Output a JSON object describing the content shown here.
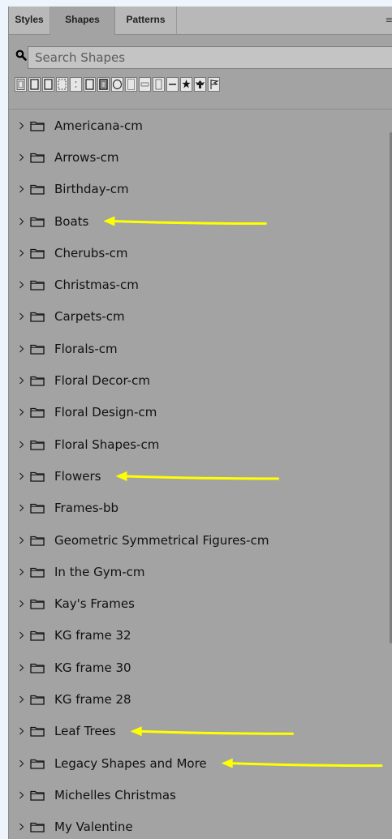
{
  "tabs": [
    {
      "label": "Styles",
      "active": false
    },
    {
      "label": "Shapes",
      "active": true
    },
    {
      "label": "Patterns",
      "active": false
    }
  ],
  "menu_icon": "panel-menu-icon",
  "search": {
    "placeholder": "Search Shapes",
    "value": "",
    "icon": "search-icon"
  },
  "colors": {
    "panel_bg": "#a3a3a3",
    "tab_bar_bg": "#b8b8b8",
    "annotation_arrow": "#ffff00",
    "page_bg": "#eef4fc"
  },
  "recent_shapes": [
    "frame-shape-icon",
    "square-frame-icon",
    "square-frame-icon",
    "dashed-frame-icon",
    "dotted-frame-icon",
    "square-frame-icon",
    "ornate-frame-icon",
    "circle-frame-icon",
    "thin-frame-icon",
    "bracket-frame-icon",
    "tall-frame-icon",
    "line-shape-icon",
    "starburst-icon",
    "eagle-icon",
    "flag-icon"
  ],
  "folders": [
    {
      "label": "Americana-cm",
      "expanded": false,
      "annotated": false
    },
    {
      "label": "Arrows-cm",
      "expanded": false,
      "annotated": false
    },
    {
      "label": "Birthday-cm",
      "expanded": false,
      "annotated": false
    },
    {
      "label": "Boats",
      "expanded": false,
      "annotated": true
    },
    {
      "label": "Cherubs-cm",
      "expanded": false,
      "annotated": false
    },
    {
      "label": "Christmas-cm",
      "expanded": false,
      "annotated": false
    },
    {
      "label": "Carpets-cm",
      "expanded": false,
      "annotated": false
    },
    {
      "label": "Florals-cm",
      "expanded": false,
      "annotated": false
    },
    {
      "label": "Floral Decor-cm",
      "expanded": false,
      "annotated": false
    },
    {
      "label": "Floral Design-cm",
      "expanded": false,
      "annotated": false
    },
    {
      "label": "Floral Shapes-cm",
      "expanded": false,
      "annotated": false
    },
    {
      "label": "Flowers",
      "expanded": false,
      "annotated": true
    },
    {
      "label": "Frames-bb",
      "expanded": false,
      "annotated": false
    },
    {
      "label": "Geometric Symmetrical Figures-cm",
      "expanded": false,
      "annotated": false
    },
    {
      "label": "In the Gym-cm",
      "expanded": false,
      "annotated": false
    },
    {
      "label": "Kay's Frames",
      "expanded": false,
      "annotated": false
    },
    {
      "label": "KG frame 32",
      "expanded": false,
      "annotated": false
    },
    {
      "label": "KG frame 30",
      "expanded": false,
      "annotated": false
    },
    {
      "label": "KG frame 28",
      "expanded": false,
      "annotated": false
    },
    {
      "label": "Leaf Trees",
      "expanded": false,
      "annotated": true
    },
    {
      "label": "Legacy Shapes and More",
      "expanded": false,
      "annotated": true
    },
    {
      "label": "Michelles Christmas",
      "expanded": false,
      "annotated": false
    },
    {
      "label": "My Valentine",
      "expanded": false,
      "annotated": false
    }
  ]
}
